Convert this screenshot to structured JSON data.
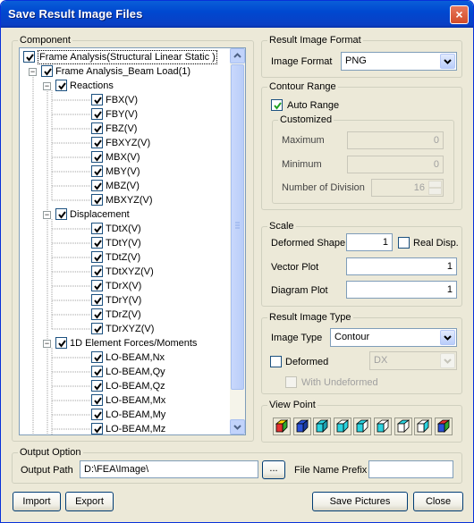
{
  "window": {
    "title": "Save Result Image Files",
    "close_glyph": "×"
  },
  "component": {
    "legend": "Component",
    "items": [
      {
        "label": "Frame Analysis(Structural Linear Static )",
        "level": 0,
        "expander": false,
        "selected": true
      },
      {
        "label": "Frame Analysis_Beam Load(1)",
        "level": 1,
        "expander": "−"
      },
      {
        "label": "Reactions",
        "level": 2,
        "expander": "−"
      },
      {
        "label": "FBX(V)",
        "level": 3
      },
      {
        "label": "FBY(V)",
        "level": 3
      },
      {
        "label": "FBZ(V)",
        "level": 3
      },
      {
        "label": "FBXYZ(V)",
        "level": 3
      },
      {
        "label": "MBX(V)",
        "level": 3
      },
      {
        "label": "MBY(V)",
        "level": 3
      },
      {
        "label": "MBZ(V)",
        "level": 3
      },
      {
        "label": "MBXYZ(V)",
        "level": 3
      },
      {
        "label": "Displacement",
        "level": 2,
        "expander": "−"
      },
      {
        "label": "TDtX(V)",
        "level": 3
      },
      {
        "label": "TDtY(V)",
        "level": 3
      },
      {
        "label": "TDtZ(V)",
        "level": 3
      },
      {
        "label": "TDtXYZ(V)",
        "level": 3
      },
      {
        "label": "TDrX(V)",
        "level": 3
      },
      {
        "label": "TDrY(V)",
        "level": 3
      },
      {
        "label": "TDrZ(V)",
        "level": 3
      },
      {
        "label": "TDrXYZ(V)",
        "level": 3
      },
      {
        "label": "1D Element Forces/Moments",
        "level": 2,
        "expander": "−"
      },
      {
        "label": "LO-BEAM,Nx",
        "level": 3
      },
      {
        "label": "LO-BEAM,Qy",
        "level": 3
      },
      {
        "label": "LO-BEAM,Qz",
        "level": 3
      },
      {
        "label": "LO-BEAM,Mx",
        "level": 3
      },
      {
        "label": "LO-BEAM,My",
        "level": 3
      },
      {
        "label": "LO-BEAM,Mz",
        "level": 3
      }
    ]
  },
  "result_image_format": {
    "legend": "Result Image Format",
    "label": "Image Format",
    "value": "PNG"
  },
  "contour_range": {
    "legend": "Contour Range",
    "auto_range_label": "Auto Range",
    "customized_legend": "Customized",
    "maximum_label": "Maximum",
    "maximum_value": "0",
    "minimum_label": "Minimum",
    "minimum_value": "0",
    "division_label": "Number of Division",
    "division_value": "16"
  },
  "scale": {
    "legend": "Scale",
    "deformed_shape_label": "Deformed Shape",
    "deformed_shape_value": "1",
    "real_disp_label": "Real Disp.",
    "vector_plot_label": "Vector Plot",
    "vector_plot_value": "1",
    "diagram_plot_label": "Diagram Plot",
    "diagram_plot_value": "1"
  },
  "result_image_type": {
    "legend": "Result Image Type",
    "image_type_label": "Image Type",
    "image_type_value": "Contour",
    "deformed_label": "Deformed",
    "deformed_value": "DX",
    "with_undeformed_label": "With Undeformed"
  },
  "view_point": {
    "legend": "View Point",
    "views": [
      "iso-view-icon",
      "front-view-icon",
      "back-view-icon",
      "left-view-icon",
      "right-view-icon",
      "top-view-icon",
      "bottom-view-icon",
      "iso-view-2-icon",
      "iso-view-3-icon"
    ]
  },
  "output_option": {
    "legend": "Output Option",
    "path_label": "Output Path",
    "path_value": "D:\\FEA\\Image\\",
    "browse_label": "...",
    "prefix_label": "File Name Prefix",
    "prefix_value": ""
  },
  "buttons": {
    "import": "Import",
    "export": "Export",
    "save": "Save Pictures",
    "close": "Close"
  }
}
